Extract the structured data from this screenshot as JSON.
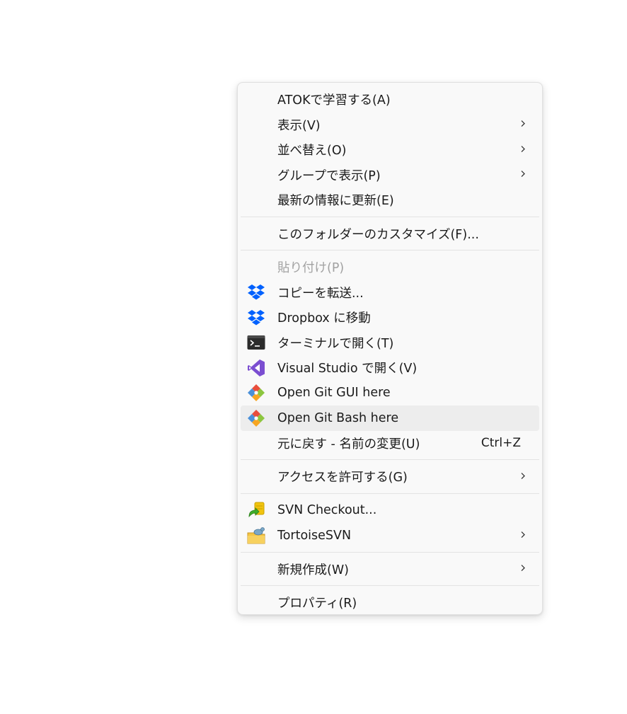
{
  "menu": {
    "items": [
      {
        "label": "ATOKで学習する(A)"
      },
      {
        "label": "表示(V)",
        "submenu": true
      },
      {
        "label": "並べ替え(O)",
        "submenu": true
      },
      {
        "label": "グループで表示(P)",
        "submenu": true
      },
      {
        "label": "最新の情報に更新(E)"
      },
      {
        "label": "このフォルダーのカスタマイズ(F)..."
      },
      {
        "label": "貼り付け(P)",
        "disabled": true
      },
      {
        "label": "コピーを転送...",
        "icon": "dropbox-icon"
      },
      {
        "label": "Dropbox に移動",
        "icon": "dropbox-icon"
      },
      {
        "label": "ターミナルで開く(T)",
        "icon": "terminal-icon"
      },
      {
        "label": "Visual Studio で開く(V)",
        "icon": "visual-studio-icon"
      },
      {
        "label": "Open Git GUI here",
        "icon": "git-gui-icon"
      },
      {
        "label": "Open Git Bash here",
        "icon": "git-bash-icon",
        "highlighted": true
      },
      {
        "label": "元に戻す - 名前の変更(U)",
        "shortcut": "Ctrl+Z"
      },
      {
        "label": "アクセスを許可する(G)",
        "submenu": true
      },
      {
        "label": "SVN Checkout...",
        "icon": "svn-checkout-icon"
      },
      {
        "label": "TortoiseSVN",
        "icon": "tortoisesvn-icon",
        "submenu": true
      },
      {
        "label": "新規作成(W)",
        "submenu": true
      },
      {
        "label": "プロパティ(R)"
      }
    ]
  },
  "colors": {
    "menu_background": "#f9f9f9",
    "hover_background": "#ededed",
    "separator": "#e3e3e3",
    "dropbox_blue": "#0061fe",
    "visual_studio_purple": "#7b4ed1",
    "disabled_text": "#a2a2a2"
  }
}
